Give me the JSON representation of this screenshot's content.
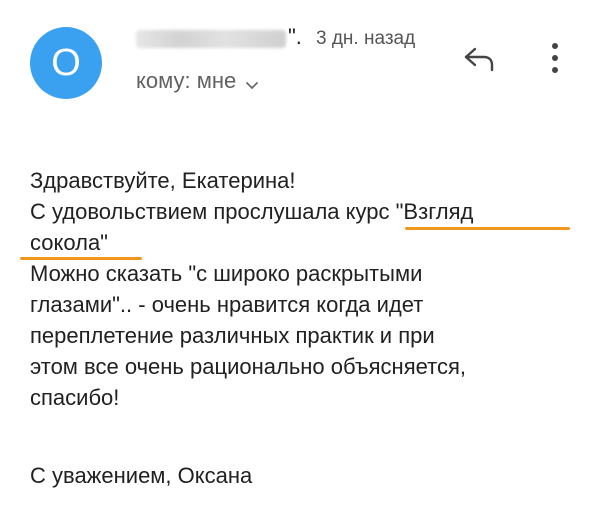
{
  "header": {
    "avatar_letter": "О",
    "sender_trailing": "\".",
    "time": "3 дн. назад",
    "recipient": "кому: мне"
  },
  "message": {
    "lines": [
      "Здравствуйте, Екатерина!",
      "С удовольствием прослушала курс \"Взгляд",
      "сокола\"",
      "Можно сказать \"с широко раскрытыми",
      "глазами\".. - очень нравится когда идет",
      "переплетение различных практик и при",
      "этом все очень рационально объясняется,",
      "спасибо!"
    ],
    "signoff": "С уважением, Оксана"
  },
  "colors": {
    "avatar_bg": "#3aa0f0",
    "underline": "#f0961e"
  },
  "icons": {
    "reply": "reply-arrow-icon",
    "more": "vertical-dots-icon",
    "expand": "chevron-down-icon"
  }
}
